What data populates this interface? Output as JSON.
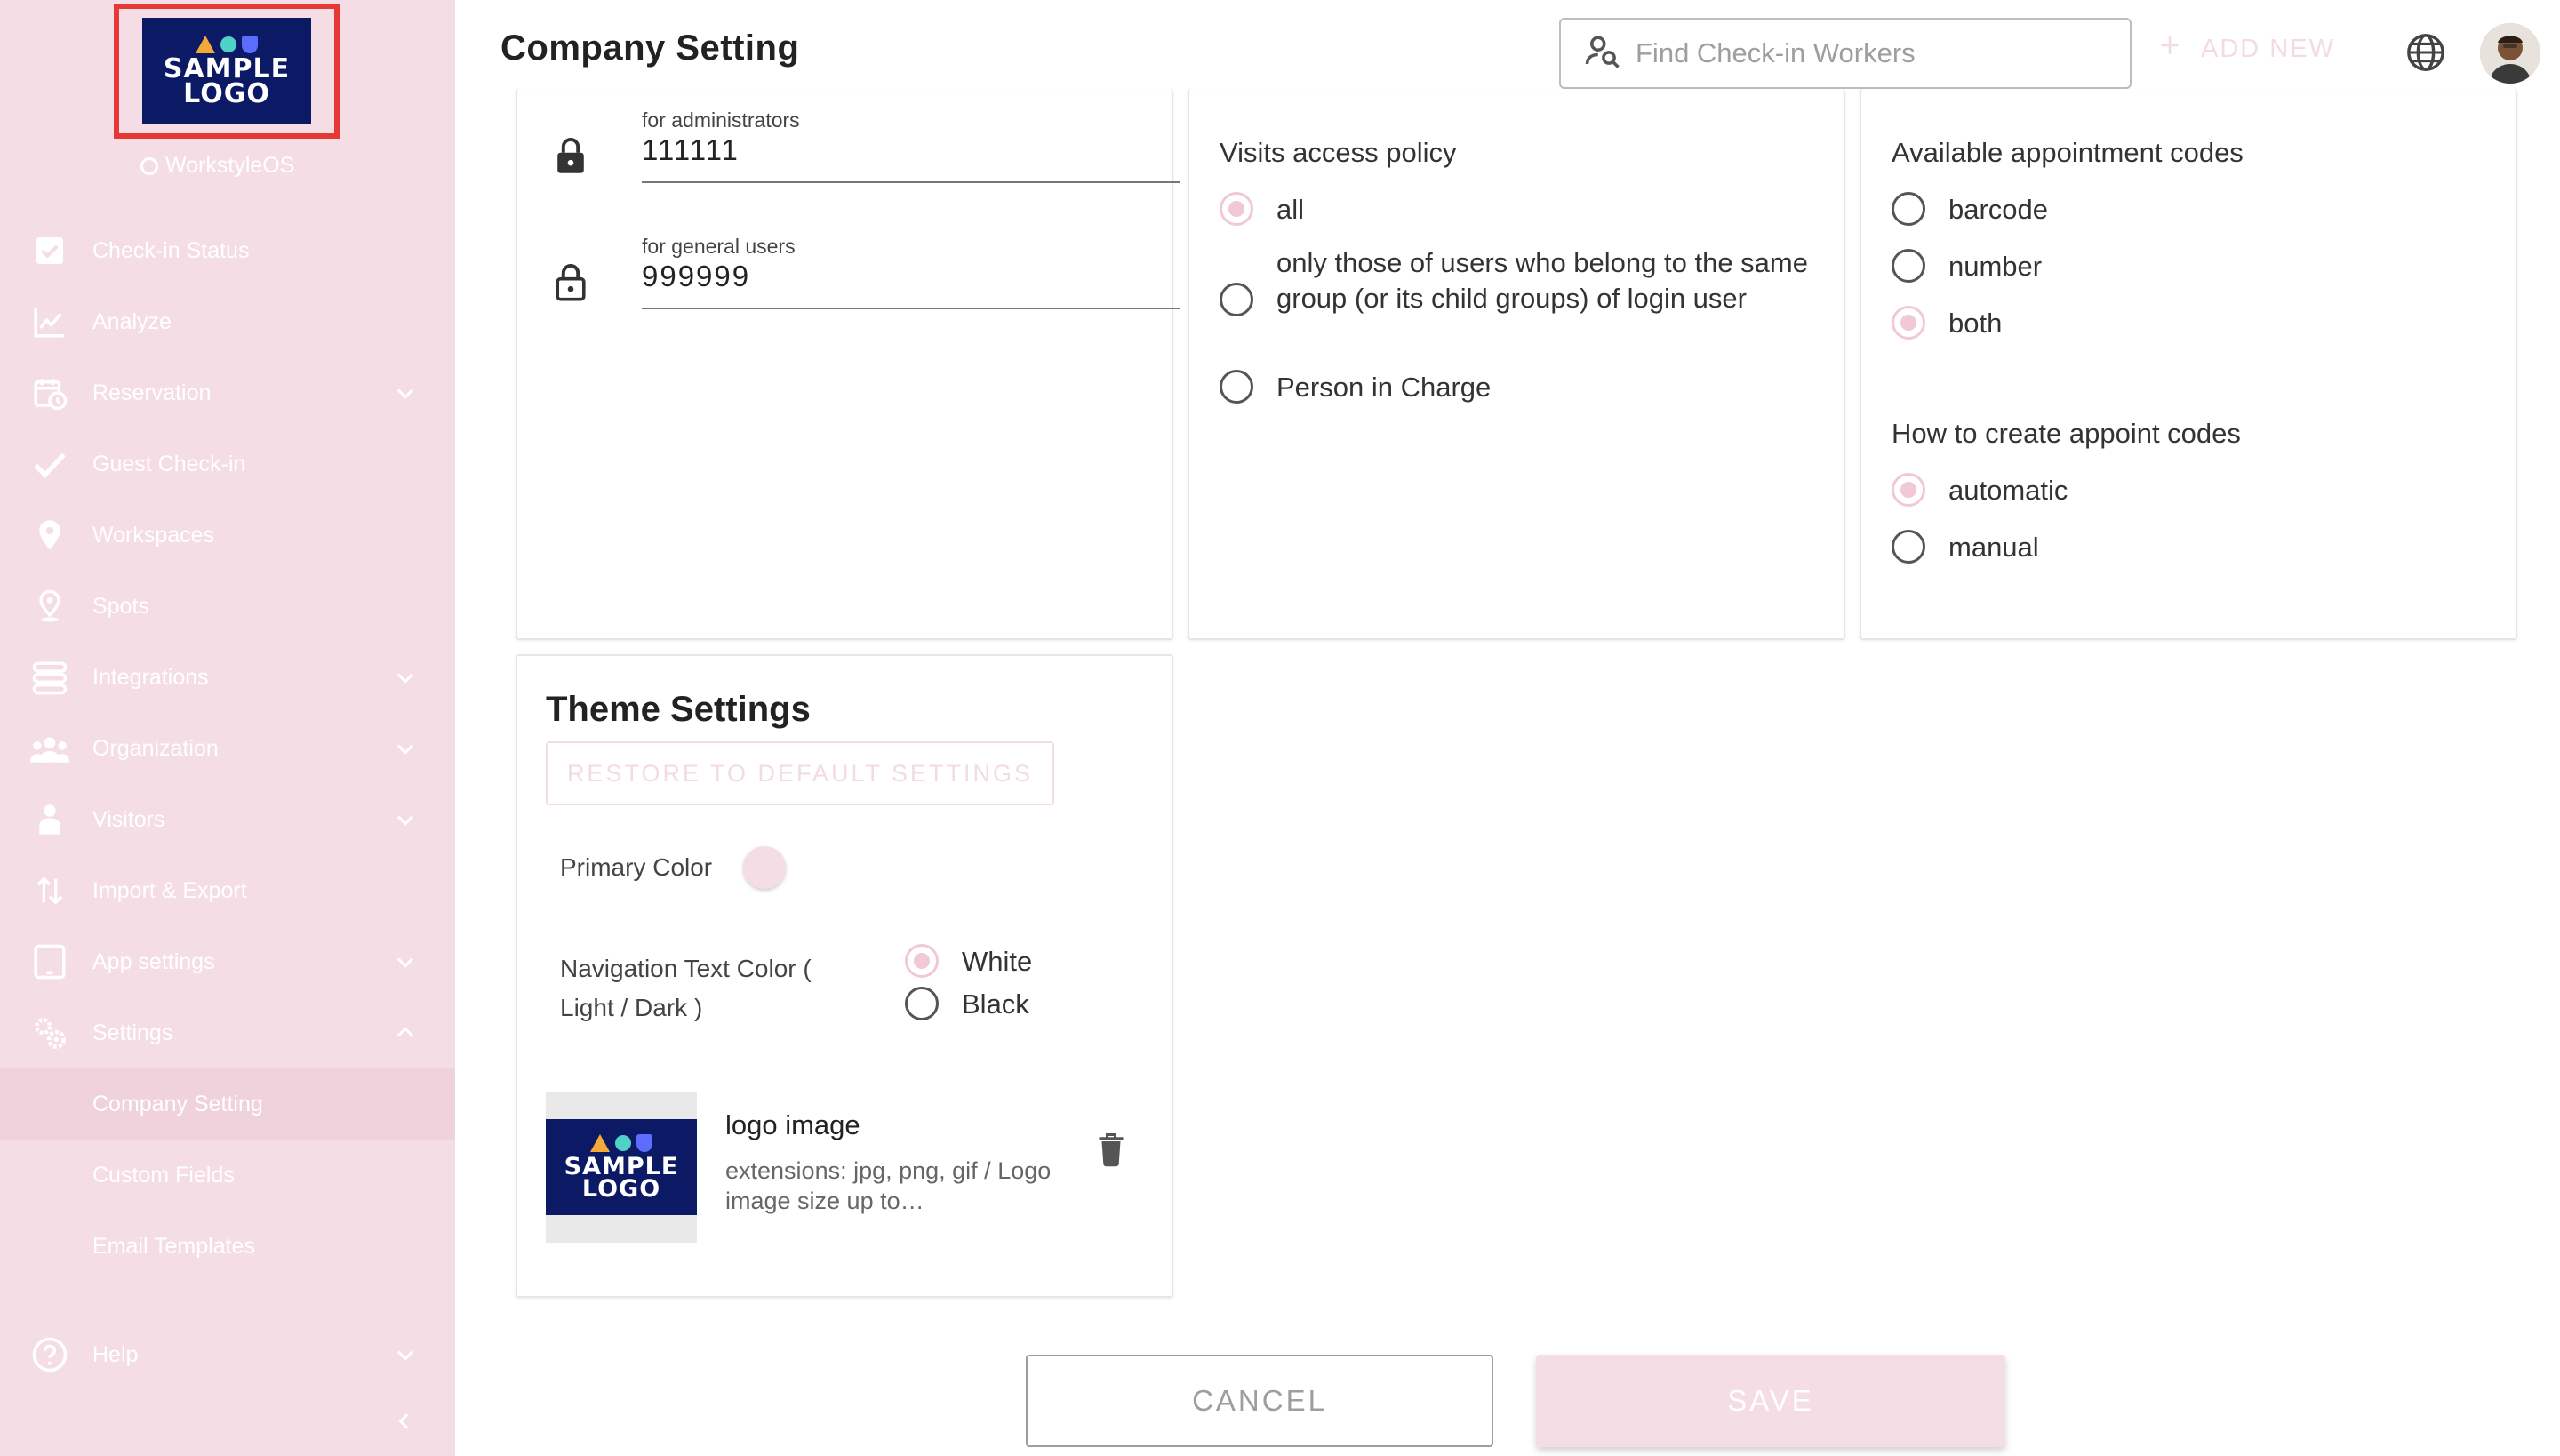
{
  "brand": {
    "logo_text": "SAMPLE LOGO",
    "product_name": "WorkstyleOS",
    "primary_color": "#f5dde6",
    "highlight_color": "#e53935"
  },
  "sidebar": {
    "items": [
      {
        "label": "Check-in Status",
        "icon": "checkbox-icon"
      },
      {
        "label": "Analyze",
        "icon": "chart-line-icon"
      },
      {
        "label": "Reservation",
        "icon": "calendar-clock-icon",
        "expandable": true
      },
      {
        "label": "Guest Check-in",
        "icon": "check-icon"
      },
      {
        "label": "Workspaces",
        "icon": "location-pin-icon"
      },
      {
        "label": "Spots",
        "icon": "spot-pin-icon"
      },
      {
        "label": "Integrations",
        "icon": "integrations-icon",
        "expandable": true
      },
      {
        "label": "Organization",
        "icon": "people-icon",
        "expandable": true
      },
      {
        "label": "Visitors",
        "icon": "visitor-icon",
        "expandable": true
      },
      {
        "label": "Import & Export",
        "icon": "import-export-icon"
      },
      {
        "label": "App settings",
        "icon": "tablet-icon",
        "expandable": true
      },
      {
        "label": "Settings",
        "icon": "gears-icon",
        "expanded": true
      }
    ],
    "sub_items": [
      {
        "label": "Company Setting",
        "active": true
      },
      {
        "label": "Custom Fields"
      },
      {
        "label": "Email Templates"
      }
    ],
    "help_label": "Help"
  },
  "header": {
    "title": "Company Setting",
    "search_placeholder": "Find Check-in Workers",
    "add_new_label": "ADD NEW"
  },
  "passwords": {
    "admin_label": "for administrators",
    "admin_value": "111111",
    "general_label": "for general users",
    "general_value": "999999"
  },
  "visits_policy": {
    "label": "Visits access policy",
    "options": [
      {
        "label": "all",
        "checked": true
      },
      {
        "label": "only those of users who belong to the same group (or its child groups) of login user",
        "checked": false
      },
      {
        "label": "Person in Charge",
        "checked": false
      }
    ]
  },
  "appointment_codes": {
    "label": "Available appointment codes",
    "options": [
      {
        "label": "barcode",
        "checked": false
      },
      {
        "label": "number",
        "checked": false
      },
      {
        "label": "both",
        "checked": true
      }
    ],
    "create_label": "How to create appoint codes",
    "create_options": [
      {
        "label": "automatic",
        "checked": true
      },
      {
        "label": "manual",
        "checked": false
      }
    ]
  },
  "theme": {
    "title": "Theme Settings",
    "restore_label": "RESTORE TO DEFAULT SETTINGS",
    "primary_color_label": "Primary Color",
    "nav_text_color_label": "Navigation Text Color ( Light / Dark )",
    "nav_options": [
      {
        "label": "White",
        "checked": true
      },
      {
        "label": "Black",
        "checked": false
      }
    ],
    "logo_title": "logo image",
    "logo_desc": "extensions: jpg, png, gif / Logo image size up to…"
  },
  "footer": {
    "cancel_label": "CANCEL",
    "save_label": "SAVE"
  }
}
